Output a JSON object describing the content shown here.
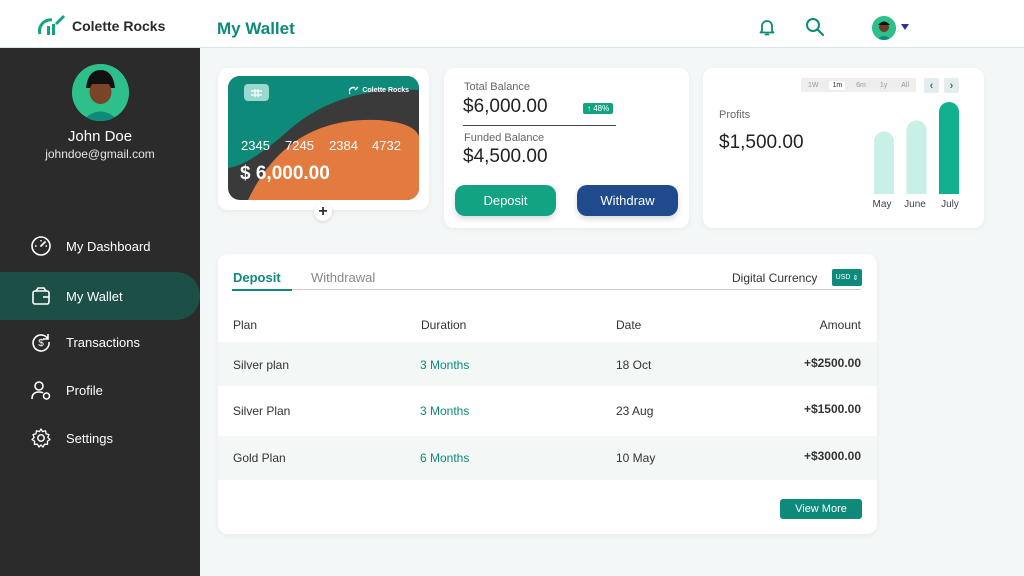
{
  "header": {
    "brand": "Colette Rocks",
    "page_title": "My Wallet",
    "icons": [
      "bell-icon",
      "search-icon",
      "user-avatar"
    ]
  },
  "user": {
    "name": "John Doe",
    "email": "johndoe@gmail.com"
  },
  "sidebar": {
    "items": [
      {
        "label": "My Dashboard",
        "icon": "speedometer-icon",
        "active": false
      },
      {
        "label": "My Wallet",
        "icon": "wallet-icon",
        "active": true
      },
      {
        "label": "Transactions",
        "icon": "dollar-cycle-icon",
        "active": false
      },
      {
        "label": "Profile",
        "icon": "user-settings-icon",
        "active": false
      },
      {
        "label": "Settings",
        "icon": "gear-icon",
        "active": false
      }
    ]
  },
  "card": {
    "brand": "Colette Rocks",
    "number": [
      "2345",
      "7245",
      "2384",
      "4732"
    ],
    "amount": "$ 6,000.00"
  },
  "balance": {
    "total_label": "Total Balance",
    "total_value": "$6,000.00",
    "change": "↑ 48%",
    "funded_label": "Funded Balance",
    "funded_value": "$4,500.00",
    "deposit_label": "Deposit",
    "withdraw_label": "Withdraw"
  },
  "profits": {
    "label": "Profits",
    "value": "$1,500.00",
    "ranges": [
      "1W",
      "1m",
      "6m",
      "1y",
      "All"
    ],
    "selected_range": "1m",
    "months": [
      "May",
      "June",
      "July"
    ]
  },
  "chart_data": {
    "type": "bar",
    "categories": [
      "May",
      "June",
      "July"
    ],
    "values": [
      0.68,
      0.8,
      1.0
    ]
  },
  "transactions": {
    "tabs": [
      "Deposit",
      "Withdrawal"
    ],
    "active_tab": "Deposit",
    "currency_label": "Digital Currency",
    "currency": "USD",
    "headers": [
      "Plan",
      "Duration",
      "Date",
      "Amount"
    ],
    "rows": [
      {
        "plan": "Silver plan",
        "duration": "3 Months",
        "date": "18 Oct",
        "amount": "+$2500.00"
      },
      {
        "plan": "Silver Plan",
        "duration": "3 Months",
        "date": "23 Aug",
        "amount": "+$1500.00"
      },
      {
        "plan": "Gold Plan",
        "duration": "6 Months",
        "date": "10 May",
        "amount": "+$3000.00"
      }
    ],
    "view_more": "View More"
  },
  "colors": {
    "accent": "#0e8a7a",
    "sidebar_bg": "#2b2b2b",
    "active_nav": "#1c4f46",
    "withdraw": "#1f4a8c",
    "card_orange": "#e37a40",
    "bar_light": "#c9f0e6",
    "bar_dark": "#12b08f"
  }
}
